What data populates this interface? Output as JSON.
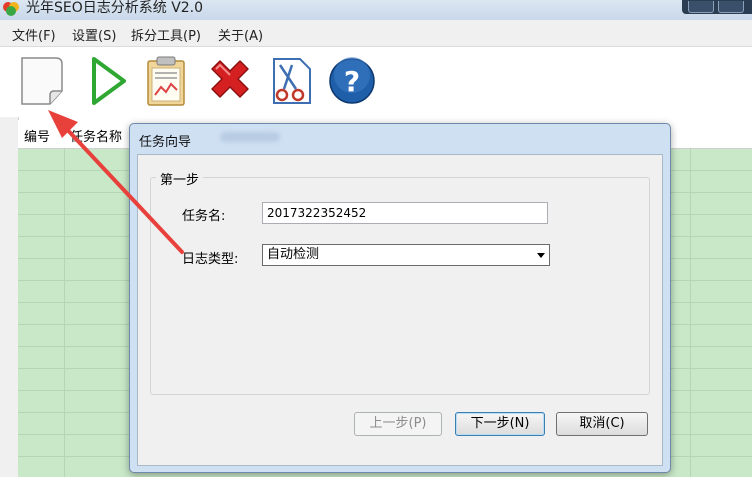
{
  "window": {
    "title": "光年SEO日志分析系统 V2.0"
  },
  "menu": {
    "items": [
      {
        "label": "文件(F)"
      },
      {
        "label": "设置(S)"
      },
      {
        "label": "拆分工具(P)"
      },
      {
        "label": "关于(A)"
      }
    ]
  },
  "toolbar": {
    "icons": [
      "new-task-icon",
      "play-icon",
      "report-icon",
      "delete-icon",
      "split-tool-icon",
      "help-icon"
    ],
    "colors": {
      "play": "#2fa833",
      "delete": "#d42020",
      "help": "#1f5ea8"
    }
  },
  "table": {
    "columns": [
      "编号",
      "任务名称"
    ],
    "row_color": "#c8e8c8"
  },
  "dialog": {
    "title": "任务向导",
    "group_label": "第一步",
    "task_name_label": "任务名:",
    "task_name_value": "2017322352452",
    "log_type_label": "日志类型:",
    "log_type_value": "自动检测",
    "prev_button": "上一步(P)",
    "next_button": "下一步(N)",
    "cancel_button": "取消(C)"
  },
  "annotation": {
    "arrow_color": "#e8413c"
  }
}
